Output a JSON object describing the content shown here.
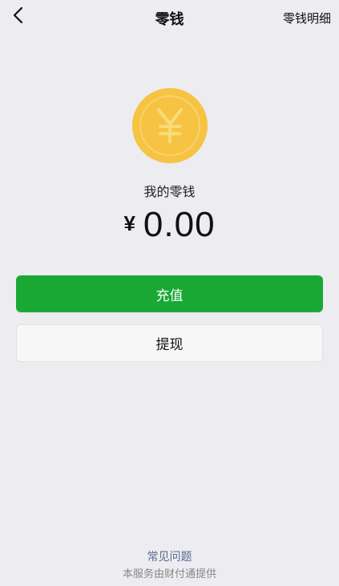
{
  "nav": {
    "title": "零钱",
    "right_link": "零钱明细",
    "back_icon": "chevron-left-icon"
  },
  "balance": {
    "coin_icon": "yen-coin-icon",
    "coin_color": "#f6c343",
    "coin_symbol": "¥",
    "label": "我的零钱",
    "currency": "¥",
    "amount": "0.00"
  },
  "actions": {
    "recharge_label": "充值",
    "recharge_color": "#1aa834",
    "withdraw_label": "提现"
  },
  "footer": {
    "faq_label": "常见问题",
    "note": "本服务由财付通提供"
  }
}
